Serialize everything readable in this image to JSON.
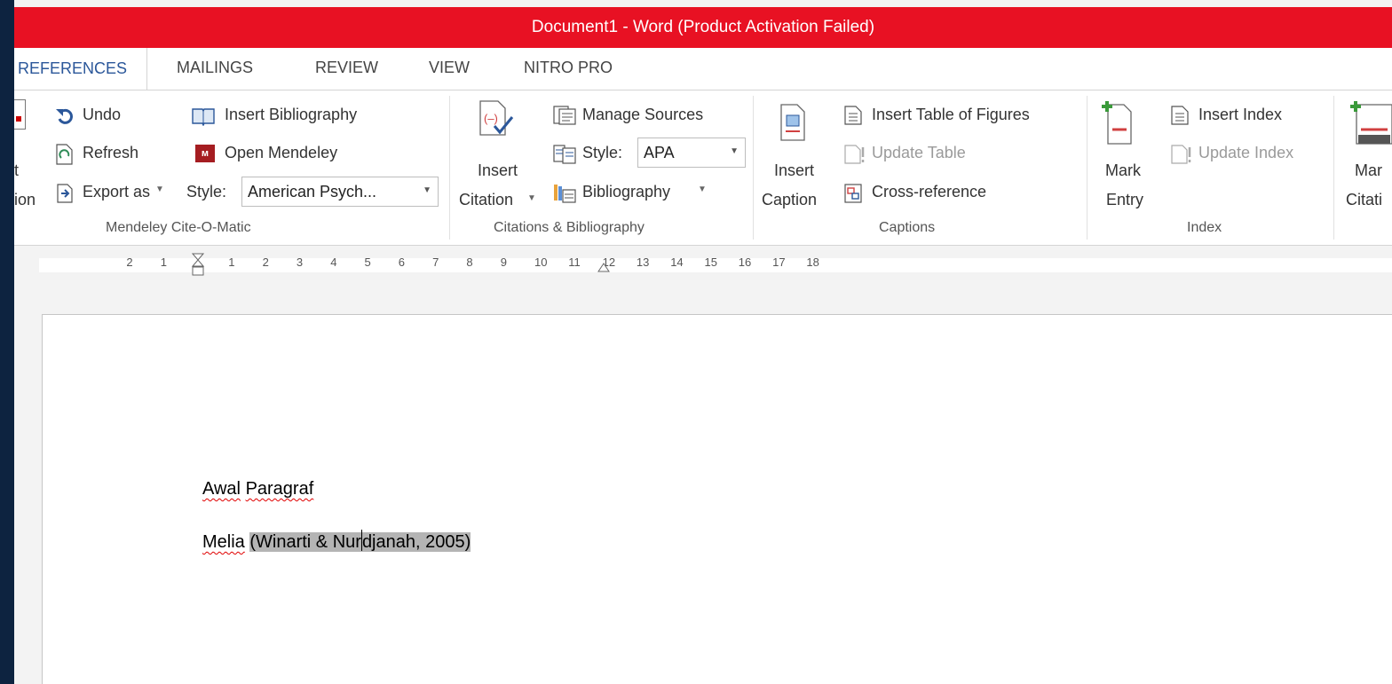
{
  "window": {
    "title": "Document1 -  Word (Product Activation Failed)"
  },
  "tabs": [
    {
      "label": "REFERENCES",
      "active": true
    },
    {
      "label": "MAILINGS"
    },
    {
      "label": "REVIEW"
    },
    {
      "label": "VIEW"
    },
    {
      "label": "NITRO PRO"
    }
  ],
  "ribbon": {
    "mendeley": {
      "insert_citation_partial_1": "t",
      "insert_citation_partial_2": "ion",
      "undo": "Undo",
      "refresh": "Refresh",
      "export_as": "Export as",
      "style_label": "Style:",
      "style_value": "American Psych...",
      "insert_bibliography": "Insert Bibliography",
      "open_mendeley": "Open Mendeley",
      "group_label": "Mendeley Cite-O-Matic"
    },
    "citations": {
      "insert_citation_line1": "Insert",
      "insert_citation_line2": "Citation",
      "manage_sources": "Manage Sources",
      "style_label": "Style:",
      "style_value": "APA",
      "bibliography": "Bibliography",
      "group_label": "Citations & Bibliography"
    },
    "captions": {
      "insert_caption_line1": "Insert",
      "insert_caption_line2": "Caption",
      "insert_table_of_figures": "Insert Table of Figures",
      "update_table": "Update Table",
      "cross_reference": "Cross-reference",
      "group_label": "Captions"
    },
    "index": {
      "mark_entry_line1": "Mark",
      "mark_entry_line2": "Entry",
      "insert_index": "Insert Index",
      "update_index": "Update Index",
      "group_label": "Index"
    },
    "toa": {
      "mark_citation_line1": "Mar",
      "mark_citation_line2": "Citati"
    }
  },
  "ruler": {
    "ticks": [
      "2",
      "1",
      "1",
      "2",
      "3",
      "4",
      "5",
      "6",
      "7",
      "8",
      "9",
      "10",
      "11",
      "12",
      "13",
      "14",
      "15",
      "16",
      "17",
      "18"
    ]
  },
  "document": {
    "line1_word1": "Awal",
    "line1_word2": "Paragraf",
    "line2_word": "Melia",
    "citation_before_cursor": "(Winarti & Nur",
    "citation_after_cursor": "djanah, 2005)"
  },
  "colors": {
    "titlebar": "#e81123",
    "accent": "#2b579a",
    "field_shade": "#b4b4b4"
  }
}
